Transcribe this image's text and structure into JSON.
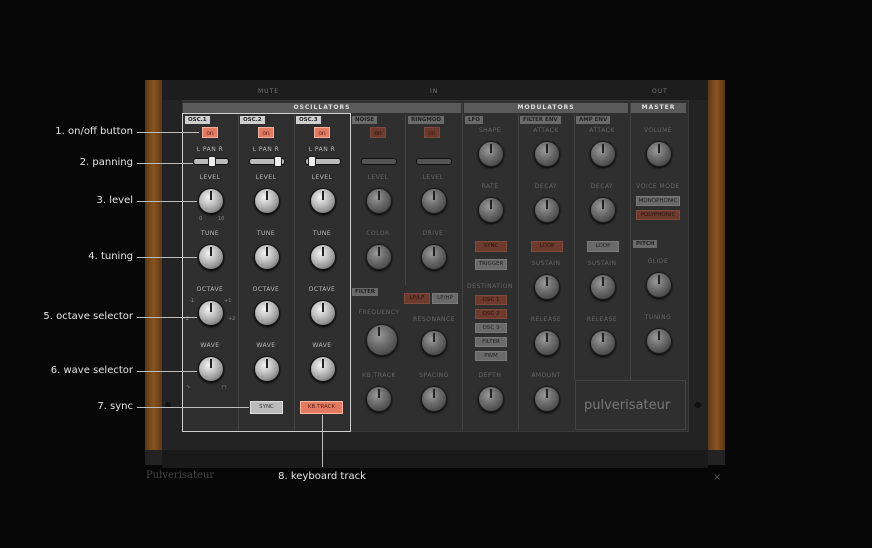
{
  "top_labels": {
    "mute": "MUTE",
    "in": "IN",
    "out": "OUT"
  },
  "brand_bottom": "Pulverisateur",
  "close_glyph": "×",
  "sections": {
    "oscillators": "OSCILLATORS",
    "modulators": "MODULATORS",
    "master": "MASTER"
  },
  "oscillators": [
    {
      "tag": "OSC.1",
      "on": "on",
      "pan": "L  PAN  R",
      "level": "LEVEL",
      "tune": "TUNE",
      "octave": "OCTAVE",
      "wave": "WAVE",
      "button": ""
    },
    {
      "tag": "OSC.2",
      "on": "on",
      "pan": "L  PAN  R",
      "level": "LEVEL",
      "tune": "TUNE",
      "octave": "OCTAVE",
      "wave": "WAVE",
      "button": "SYNC"
    },
    {
      "tag": "OSC.3",
      "on": "on",
      "pan": "L  PAN  R",
      "level": "LEVEL",
      "tune": "TUNE",
      "octave": "OCTAVE",
      "wave": "WAVE",
      "button": "KB.TRACK"
    }
  ],
  "scales": {
    "level_left": "0",
    "level_right": "10",
    "oct_left": "-1",
    "oct_right": "+1",
    "oct_ll": "-2",
    "oct_rr": "+2",
    "oct_bl": "-3",
    "oct_br": "+3"
  },
  "noise": {
    "tag": "NOISE",
    "on": "on",
    "level": "LEVEL",
    "color": "COLOR"
  },
  "ringmod": {
    "tag": "RINGMOD",
    "on": "on",
    "level": "LEVEL",
    "drive": "DRIVE"
  },
  "filter": {
    "tag": "FILTER",
    "mode_a": "LP/LP",
    "mode_b": "LP/HP",
    "frequency": "FREQUENCY",
    "resonance": "RESONANCE",
    "kb_track": "KB.TRACK",
    "spacing": "SPACING"
  },
  "lfo": {
    "tag": "LFO",
    "shape": "SHAPE",
    "rate": "RATE",
    "sync": "SYNC",
    "trigger": "TRIGGER",
    "destination": "DESTINATION",
    "destinations": [
      "OSC 1",
      "OSC 2",
      "OSC 3",
      "FILTER",
      "PWM"
    ],
    "depth": "DEPTH"
  },
  "filter_env": {
    "tag": "FILTER ENV",
    "attack": "ATTACK",
    "decay": "DECAY",
    "loop": "LOOP",
    "sustain": "SUSTAIN",
    "release": "RELEASE",
    "amount": "AMOUNT"
  },
  "amp_env": {
    "tag": "AMP ENV",
    "attack": "ATTACK",
    "decay": "DECAY",
    "loop": "LOOP",
    "sustain": "SUSTAIN",
    "release": "RELEASE"
  },
  "master": {
    "volume": "VOLUME",
    "voice_mode": "VOICE MODE",
    "mono": "MONOPHONIC",
    "poly": "POLYPHONIC",
    "pitch_tag": "PITCH",
    "glide": "GLIDE",
    "tuning": "TUNING"
  },
  "logo": "pulverisateur",
  "callouts": {
    "c1": "1. on/off button",
    "c2": "2. panning",
    "c3": "3. level",
    "c4": "4. tuning",
    "c5": "5. octave selector",
    "c6": "6. wave selector",
    "c7": "7. sync",
    "c8": "8. keyboard track"
  },
  "colors": {
    "accent_on": "#e37b63",
    "panel": "#2f2f2f",
    "wood": "#8a5420",
    "background": "#070707"
  }
}
